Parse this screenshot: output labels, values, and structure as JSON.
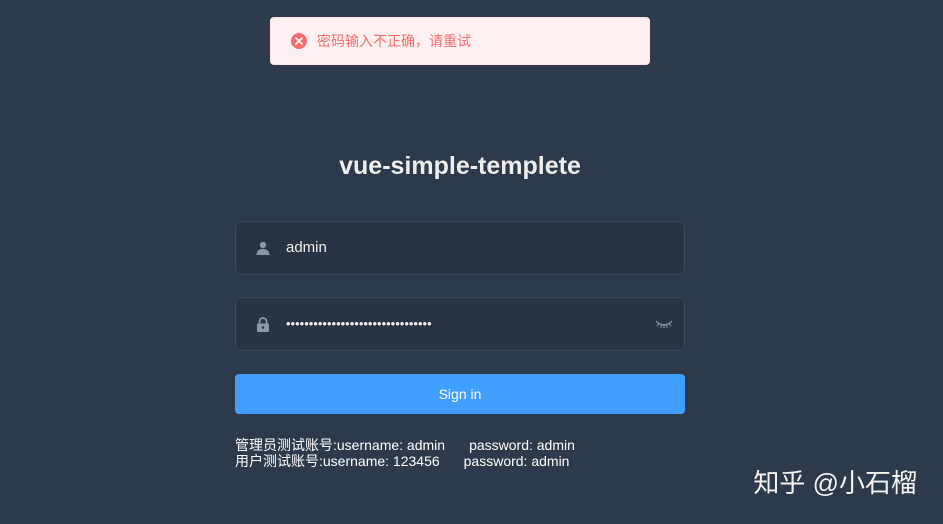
{
  "colors": {
    "background": "#2d3a4b",
    "input_background": "#283443",
    "primary": "#409eff",
    "error": "#f56c6c",
    "error_background": "#fef0f0"
  },
  "toast": {
    "type": "error",
    "icon": "error-circle-icon",
    "message": "密码输入不正确，请重试"
  },
  "title": "vue-simple-templete",
  "form": {
    "username": {
      "icon": "user-icon",
      "value": "admin"
    },
    "password": {
      "icon": "lock-icon",
      "masked_value": "••••••••••••••••••••••••••••••••",
      "toggle_icon": "eye-closed-icon"
    },
    "submit_label": "Sign in"
  },
  "tips": [
    {
      "account": "管理员测试账号:username: admin",
      "password": "password: admin"
    },
    {
      "account": "用户测试账号:username: 123456",
      "password": "password: admin"
    }
  ],
  "watermark": "知乎 @小石榴"
}
